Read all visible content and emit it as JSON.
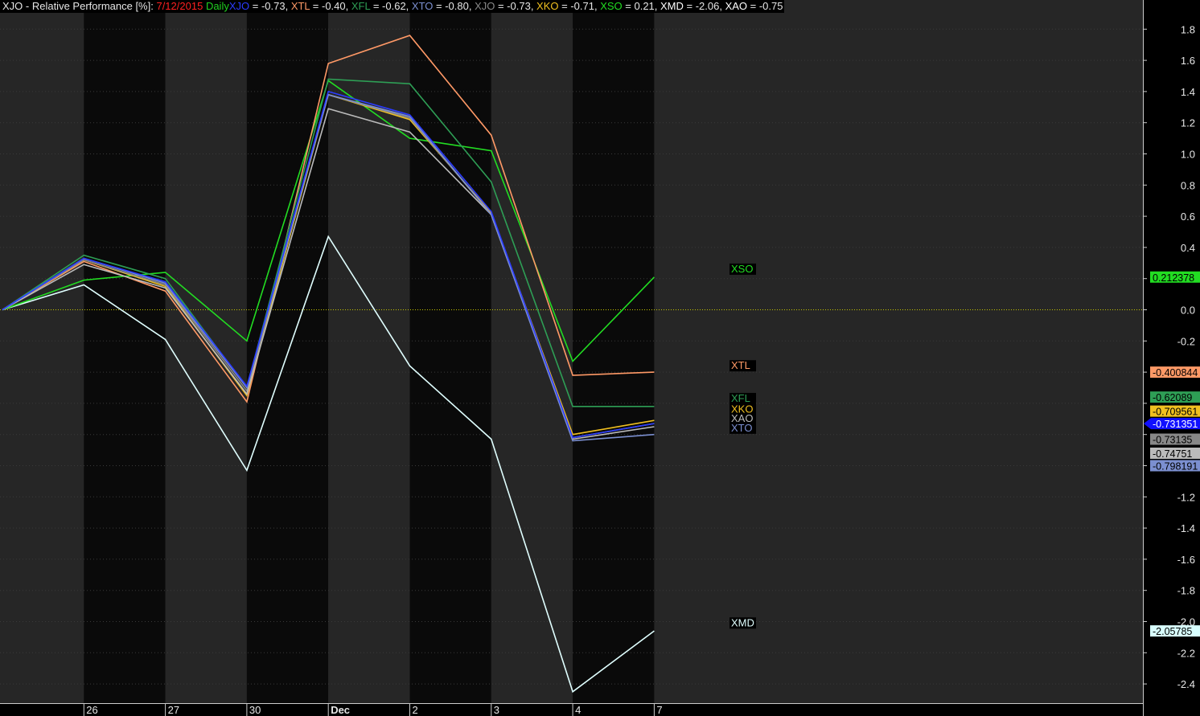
{
  "title": {
    "chart_name": "XJO - Relative Performance [%]:",
    "date": "7/12/2015",
    "interval": "Daily",
    "date_color": "#ff2020",
    "interval_color": "#20d020",
    "header_values": [
      {
        "label": "XJO",
        "text": " = -0.73,",
        "color": "#2b3cff"
      },
      {
        "label": "XTL",
        "text": " = -0.40,",
        "color": "#ff9966"
      },
      {
        "label": "XFL",
        "text": " = -0.62,",
        "color": "#2e9e55"
      },
      {
        "label": "XTO",
        "text": " = -0.80,",
        "color": "#7b8fd0"
      },
      {
        "label": "XJO",
        "text": " = -0.73,",
        "color": "#888888"
      },
      {
        "label": "XKO",
        "text": " = -0.71,",
        "color": "#f0c020"
      },
      {
        "label": "XSO",
        "text": " = 0.21,",
        "color": "#22dd22"
      },
      {
        "label": "XMD",
        "text": " = -2.06,",
        "color": "#ffffff"
      },
      {
        "label": "XAO",
        "text": " = -0.75",
        "color": "#ffffff"
      }
    ]
  },
  "chart_data": {
    "type": "line",
    "categories": [
      "",
      "26",
      "27",
      "30",
      "Dec",
      "2",
      "3",
      "4",
      "7"
    ],
    "ylim": [
      -2.6,
      1.9
    ],
    "yticks": [
      1.8,
      1.6,
      1.4,
      1.2,
      1.0,
      0.8,
      0.6,
      0.4,
      0.2,
      0.0,
      -0.2,
      -0.4,
      -0.6,
      -0.8,
      -1.0,
      -1.2,
      -1.4,
      -1.6,
      -1.8,
      -2.0,
      -2.2,
      -2.4
    ],
    "ytick_labels": [
      "1.8",
      "1.6",
      "1.4",
      "1.2",
      "1.0",
      "0.8",
      "0.6",
      "0.4",
      "",
      "0.0",
      "-0.2",
      "",
      "",
      "",
      "",
      "-1.2",
      "-1.4",
      "-1.6",
      "-1.8",
      "-2.0",
      "-2.2",
      "-2.4"
    ],
    "zero_line_color": "#c8c800",
    "band_colors": [
      "#262626",
      "#0a0a0a"
    ],
    "empty_area_color": "#262626",
    "series": [
      {
        "name": "XMD",
        "color": "#e0ffff",
        "values": [
          0,
          0.16,
          -0.19,
          -1.03,
          0.47,
          -0.36,
          -0.83,
          -2.45,
          -2.06
        ],
        "label": "XMD",
        "label_y": -2.03,
        "tag_text": "-2.05785",
        "tag_bg": "#d8ffff",
        "tag_y": -2.06
      },
      {
        "name": "XSO",
        "color": "#22dd22",
        "values": [
          0,
          0.19,
          0.24,
          -0.2,
          1.47,
          1.1,
          1.02,
          -0.33,
          0.21
        ],
        "label": "XSO",
        "label_y": 0.24,
        "tag_text": "0.212378",
        "tag_bg": "#22dd22",
        "tag_y": 0.21
      },
      {
        "name": "XTL",
        "color": "#ff9966",
        "values": [
          0,
          0.31,
          0.12,
          -0.59,
          1.58,
          1.76,
          1.12,
          -0.42,
          -0.4
        ],
        "label": "XTL",
        "label_y": -0.38,
        "tag_text": "-0.400844",
        "tag_bg": "#ff9966",
        "tag_y": -0.4
      },
      {
        "name": "XFL",
        "color": "#2e9e55",
        "values": [
          0,
          0.35,
          0.2,
          -0.5,
          1.48,
          1.45,
          0.82,
          -0.62,
          -0.62
        ],
        "label": "XFL",
        "label_y": -0.59,
        "tag_text": "-0.62089",
        "tag_bg": "#2e9e55",
        "tag_y": -0.56
      },
      {
        "name": "XKO",
        "color": "#f0c020",
        "values": [
          0,
          0.32,
          0.15,
          -0.55,
          1.38,
          1.22,
          0.62,
          -0.8,
          -0.71
        ],
        "label": "XKO",
        "label_y": -0.66,
        "tag_text": "-0.709561",
        "tag_bg": "#f0c020",
        "tag_y": -0.65
      },
      {
        "name": "XJO",
        "color": "#888888",
        "values": [
          0,
          0.32,
          0.16,
          -0.52,
          1.38,
          1.23,
          0.61,
          -0.82,
          -0.73
        ],
        "tag_text": "-0.73135",
        "tag_bg": "#888888",
        "tag_y": -0.83
      },
      {
        "name": "XAO",
        "color": "#bbbbbb",
        "values": [
          0,
          0.29,
          0.14,
          -0.54,
          1.29,
          1.14,
          0.61,
          -0.83,
          -0.75
        ],
        "label": "XAO",
        "label_y": -0.72,
        "tag_text": "-0.74751",
        "tag_bg": "#bbbbbb",
        "tag_y": -0.92
      },
      {
        "name": "XTO",
        "color": "#7b8fd0",
        "values": [
          0,
          0.33,
          0.17,
          -0.5,
          1.38,
          1.24,
          0.61,
          -0.84,
          -0.8
        ],
        "label": "XTO",
        "label_y": -0.78,
        "tag_text": "-0.798191",
        "tag_bg": "#7b8fd0",
        "tag_y": -1.0
      },
      {
        "name": "XJO",
        "color": "#2b3cff",
        "values": [
          0,
          0.33,
          0.18,
          -0.49,
          1.4,
          1.25,
          0.63,
          -0.82,
          -0.73
        ],
        "tag_text": "-0.731351",
        "tag_bg": "#1010ff",
        "tag_fg": "#ffffff",
        "tag_y": -0.73,
        "tag_arrow": true
      }
    ]
  }
}
